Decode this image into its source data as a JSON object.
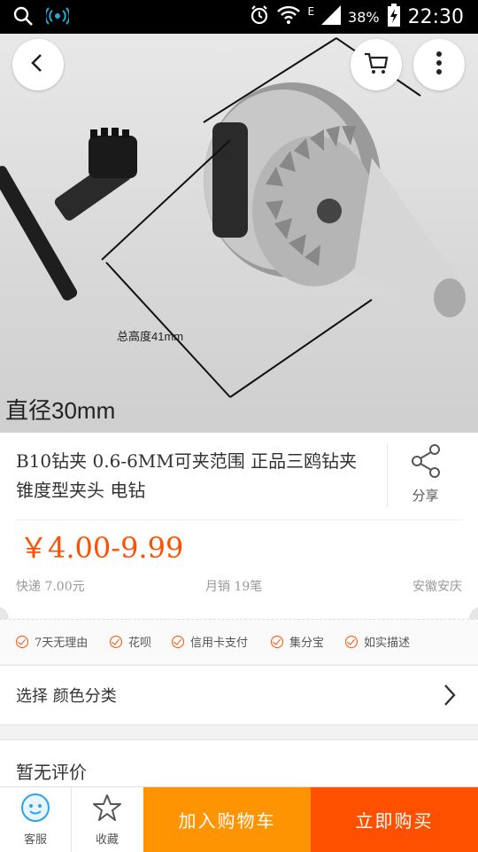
{
  "status_bar": {
    "network_type": "E",
    "battery": "38%",
    "time": "22:30"
  },
  "hero": {
    "image_annotation": "总高度41mm",
    "caption": "直径30mm",
    "icons": [
      "back-icon",
      "cart-icon",
      "more-icon"
    ]
  },
  "product": {
    "title": "B10钻夹 0.6-6MM可夹范围 正品三鸥钻夹 锥度型夹头 电钻",
    "share_label": "分享",
    "price": "￥4.00-9.99",
    "shipping": "快递 7.00元",
    "monthly_sales": "月销 19笔",
    "location": "安徽安庆"
  },
  "promises": [
    "7天无理由",
    "花呗",
    "信用卡支付",
    "集分宝",
    "如实描述"
  ],
  "options": {
    "label": "选择 颜色分类"
  },
  "reviews": {
    "label": "暂无评价"
  },
  "bottom_bar": {
    "service_label": "客服",
    "favorite_label": "收藏",
    "add_to_cart": "加入购物车",
    "buy_now": "立即购买"
  },
  "colors": {
    "accent": "#ff5000",
    "cart_button": "#ff9402",
    "service_icon": "#29a1f7"
  }
}
